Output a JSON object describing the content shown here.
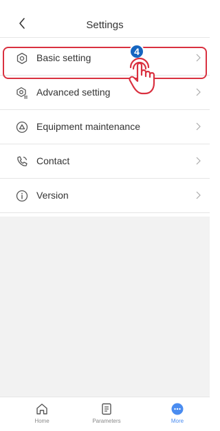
{
  "header": {
    "title": "Settings"
  },
  "menu": [
    {
      "label": "Basic setting",
      "icon": "gear-icon"
    },
    {
      "label": "Advanced setting",
      "icon": "advanced-gear-icon"
    },
    {
      "label": "Equipment maintenance",
      "icon": "maintenance-icon"
    },
    {
      "label": "Contact",
      "icon": "phone-icon"
    },
    {
      "label": "Version",
      "icon": "info-icon"
    }
  ],
  "annotation": {
    "step": "4",
    "color": "#d9303f",
    "badge_color": "#1565c0"
  },
  "tabbar": [
    {
      "label": "Home",
      "icon": "home-icon",
      "active": false
    },
    {
      "label": "Parameters",
      "icon": "document-icon",
      "active": false
    },
    {
      "label": "More",
      "icon": "more-icon",
      "active": true
    }
  ],
  "colors": {
    "accent": "#4a8cf0",
    "background": "#f2f2f2"
  }
}
